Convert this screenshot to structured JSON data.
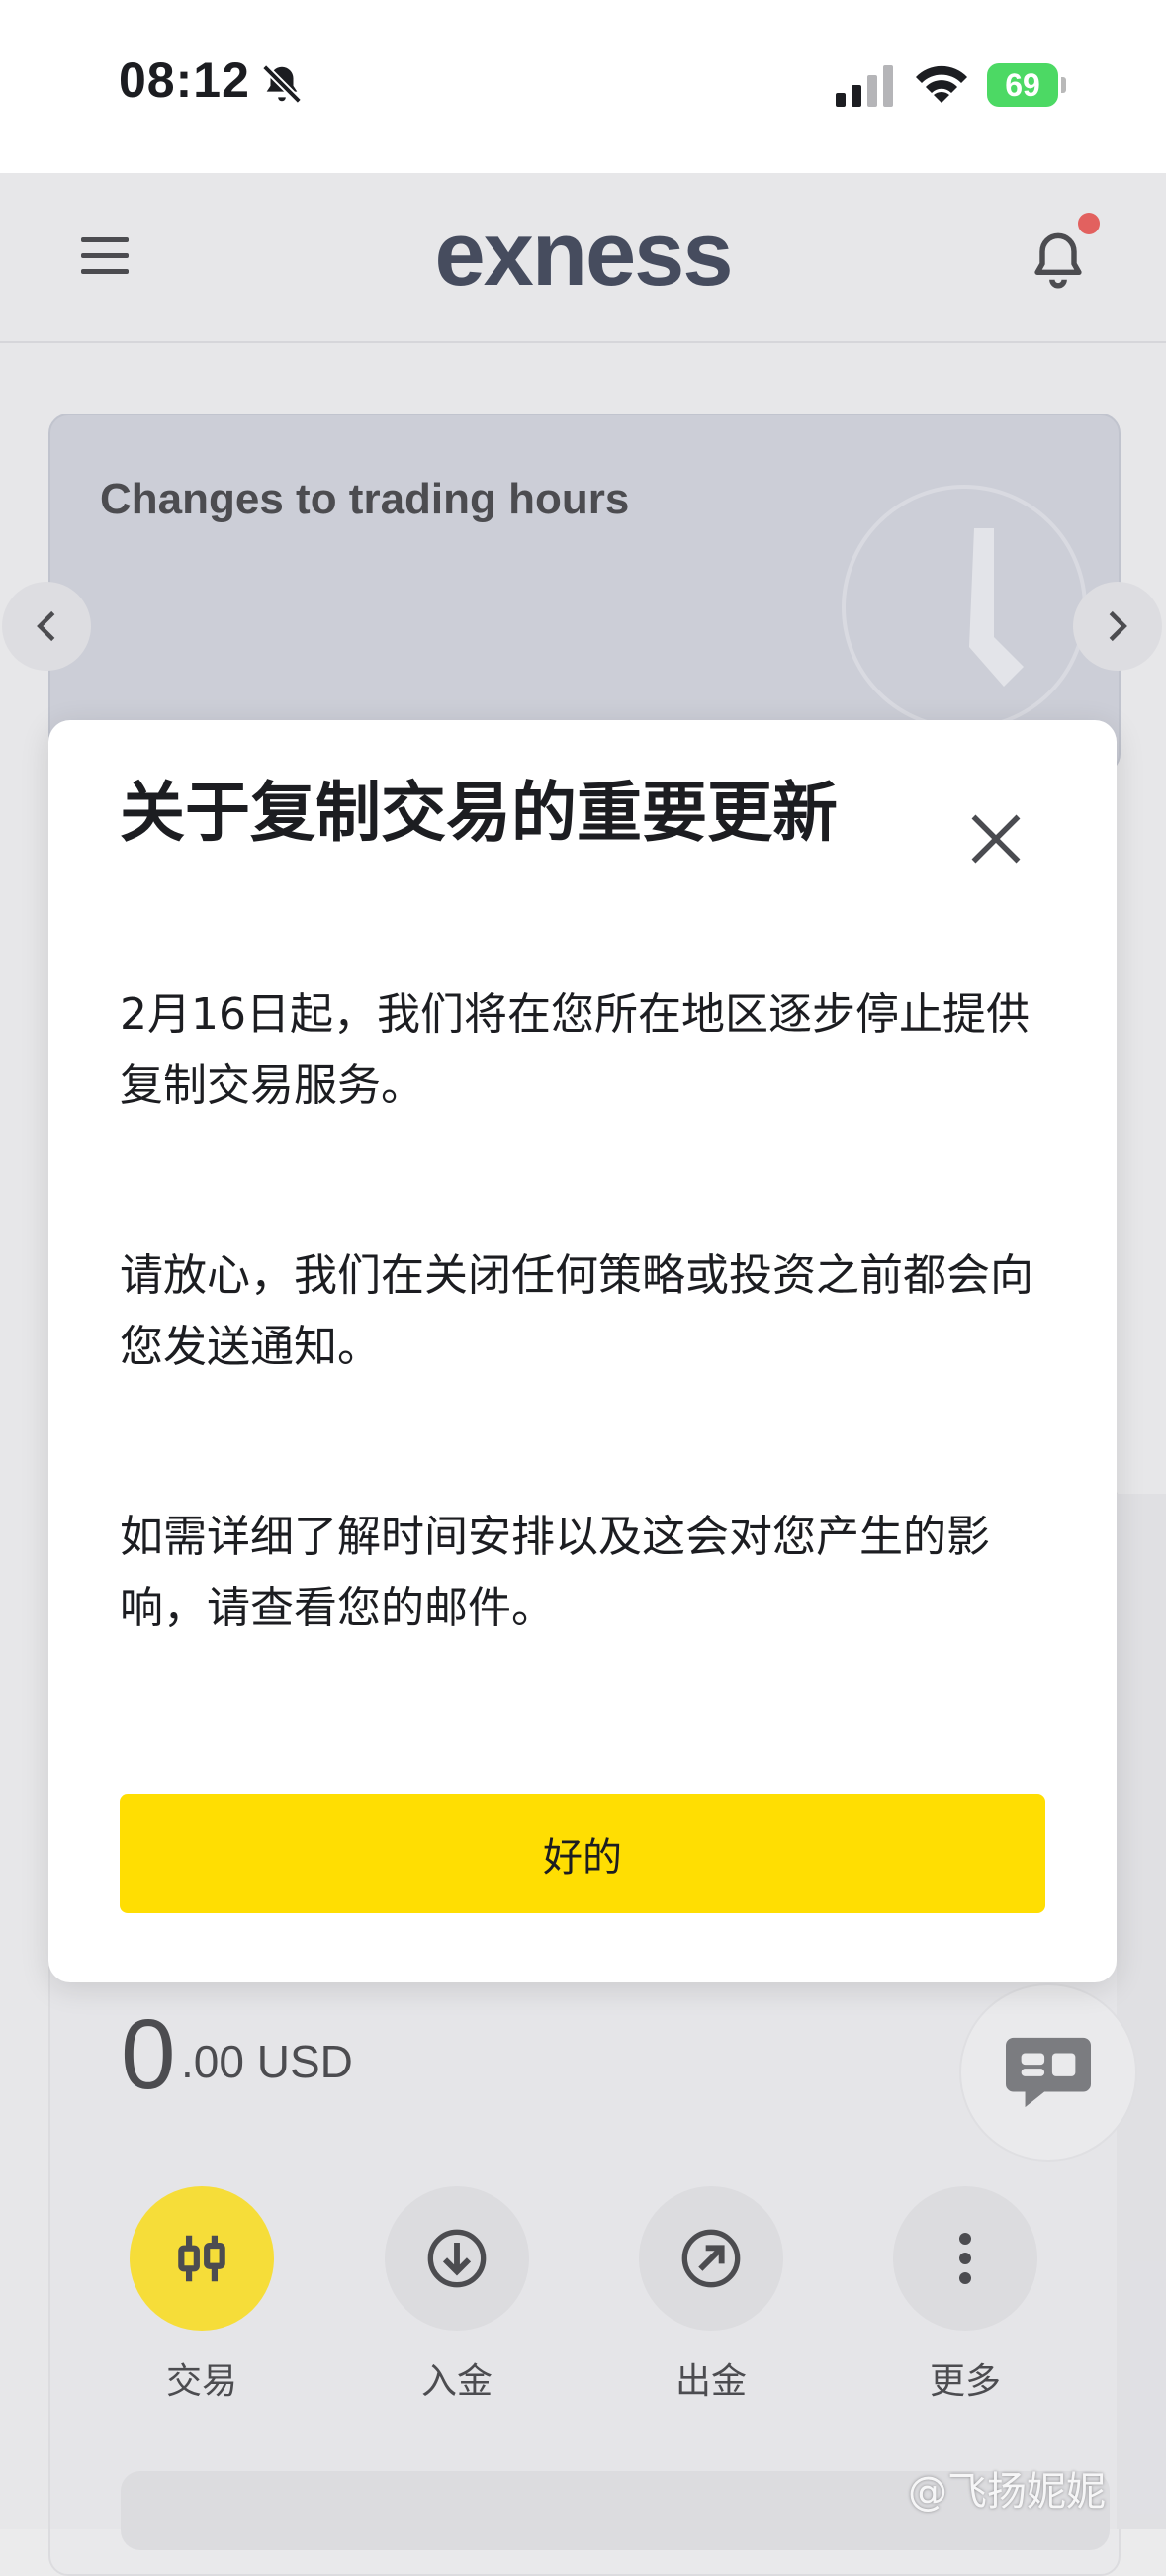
{
  "status_bar": {
    "time": "08:12",
    "battery": "69",
    "icons": [
      "bell-slash-icon",
      "cellular-signal-icon",
      "wifi-icon",
      "battery-charging-icon"
    ]
  },
  "header": {
    "logo": "exness",
    "icons": [
      "hamburger-menu-icon",
      "bell-icon"
    ],
    "notification_dot_color": "#e53935"
  },
  "banner": {
    "title": "Changes to trading hours"
  },
  "modal": {
    "title": "关于复制交易的重要更新",
    "paragraphs": [
      "2月16日起，我们将在您所在地区逐步停止提供复制交易服务。",
      "请放心，我们在关闭任何策略或投资之前都会向您发送通知。",
      "如需详细了解时间安排以及这会对您产生的影响，请查看您的邮件。"
    ],
    "ok_label": "好的"
  },
  "account": {
    "balance_int": "0",
    "balance_rest": ".00 USD",
    "actions": [
      {
        "label": "交易",
        "icon": "candlestick-icon"
      },
      {
        "label": "入金",
        "icon": "arrow-down-circle-icon"
      },
      {
        "label": "出金",
        "icon": "arrow-up-right-circle-icon"
      },
      {
        "label": "更多",
        "icon": "more-vertical-icon"
      }
    ]
  },
  "watermark": "@飞扬妮妮",
  "colors": {
    "accent": "#ffde02",
    "background": "#ebebec",
    "text": "#1c1d21"
  }
}
